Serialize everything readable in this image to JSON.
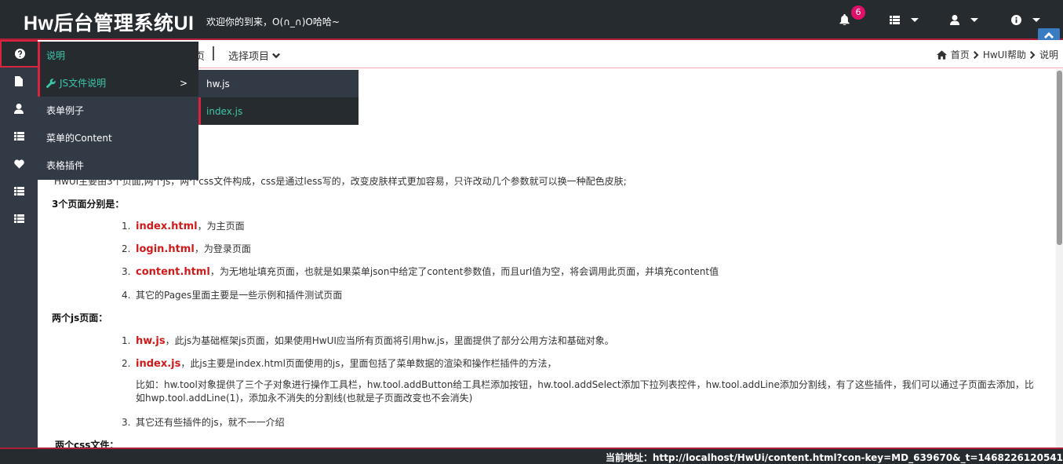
{
  "header": {
    "brand": "Hw后台管理系统UI",
    "welcome": "欢迎你的到来，O(∩_∩)O哈哈~",
    "notification_count": "6"
  },
  "toolbar": {
    "partial_label": "页",
    "select_label": "选择项目"
  },
  "breadcrumb": {
    "items": [
      "首页",
      "HwUI帮助",
      "说明"
    ]
  },
  "menu": {
    "items": [
      {
        "label": "说明"
      },
      {
        "label": "JS文件说明",
        "arrow": ">"
      },
      {
        "label": "表单例子"
      },
      {
        "label": "菜单的Content"
      },
      {
        "label": "表格插件"
      }
    ],
    "submenu": [
      {
        "label": "hw.js"
      },
      {
        "label": "index.js"
      }
    ]
  },
  "content": {
    "intro": "HwUI主要由3个页面,两个js，两个css文件构成，css是通过less写的，改变皮肤样式更加容易，只许改动几个参数就可以换一种配色皮肤;",
    "sec_pages": "3个页面分别是：",
    "pages": [
      {
        "num": "1.",
        "kw": "index.html",
        "desc": "，为主页面"
      },
      {
        "num": "2.",
        "kw": "login.html",
        "desc": "，为登录页面"
      },
      {
        "num": "3.",
        "kw": "content.html",
        "desc": "，为无地址填充页面，也就是如果菜单json中给定了content参数值，而且url值为空，将会调用此页面，并填充content值"
      },
      {
        "num": "4.",
        "kw": "",
        "desc": "其它的Pages里面主要是一些示例和插件测试页面"
      }
    ],
    "sec_js": "两个js页面：",
    "js": [
      {
        "num": "1.",
        "kw": "hw.js",
        "desc": "，此js为基础框架js页面，如果使用HwUI应当所有页面将引用hw.js，里面提供了部分公用方法和基础对象。"
      },
      {
        "num": "2.",
        "kw": "index.js",
        "desc": "，此js主要是index.html页面使用的js，里面包括了菜单数据的渲染和操作栏插件的方法，"
      }
    ],
    "js_para": "比如：hw.tool对象提供了三个子对象进行操作工具栏，hw.tool.addButton给工具栏添加按钮，hw.tool.addSelect添加下拉列表控件，hw.tool.addLine添加分割线，有了这些插件，我们可以通过子页面去添加，比如hwp.tool.addLine(1)，添加永不消失的分割线(也就是子页面改变也不会消失)",
    "js_3": {
      "num": "3.",
      "desc": "其它还有些插件的js，就不一一介绍"
    },
    "sec_css": "两个css文件："
  },
  "footer": {
    "address": "当前地址：http://localhost/HwUi/content.html?con-key=MD_639670&_t=1468226120541"
  }
}
